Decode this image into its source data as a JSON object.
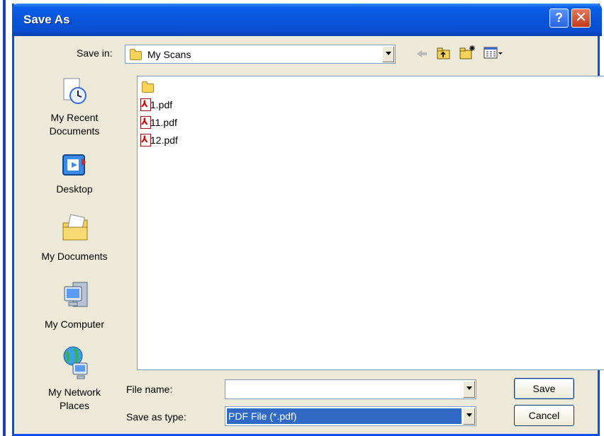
{
  "window": {
    "title": "Save As"
  },
  "toolbar": {
    "save_in_label": "Save in:",
    "save_in_value": "My Scans",
    "icons": [
      "back-arrow-icon",
      "up-folder-icon",
      "new-folder-icon",
      "views-menu-icon"
    ]
  },
  "places": [
    {
      "label_line1": "My Recent",
      "label_line2": "Documents",
      "icon": "recent-documents-icon"
    },
    {
      "label_line1": "Desktop",
      "label_line2": "",
      "icon": "desktop-icon"
    },
    {
      "label_line1": "My Documents",
      "label_line2": "",
      "icon": "my-documents-icon"
    },
    {
      "label_line1": "My Computer",
      "label_line2": "",
      "icon": "my-computer-icon"
    },
    {
      "label_line1": "My Network",
      "label_line2": "Places",
      "icon": "network-places-icon"
    }
  ],
  "files": [
    {
      "name": "",
      "type": "folder"
    },
    {
      "name": "1.pdf",
      "type": "pdf"
    },
    {
      "name": "11.pdf",
      "type": "pdf"
    },
    {
      "name": "12.pdf",
      "type": "pdf"
    }
  ],
  "form": {
    "file_name_label": "File name:",
    "file_name_value": "",
    "save_as_type_label": "Save as type:",
    "save_as_type_value": "PDF File (*.pdf)"
  },
  "buttons": {
    "save": "Save",
    "cancel": "Cancel"
  },
  "colors": {
    "titlebar": "#0853d8",
    "selection": "#316ac5",
    "dialog_bg": "#ece9d8"
  }
}
